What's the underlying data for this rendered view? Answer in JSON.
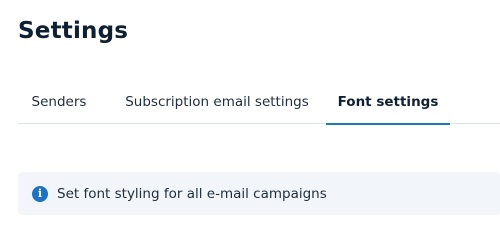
{
  "page": {
    "title": "Settings"
  },
  "tabs": [
    {
      "label": "Senders",
      "active": false
    },
    {
      "label": "Subscription email settings",
      "active": false
    },
    {
      "label": "Font settings",
      "active": true
    }
  ],
  "info_banner": {
    "icon": "info-icon",
    "text": "Set font styling for all e-mail campaigns"
  },
  "colors": {
    "accent": "#1f7ab8",
    "info_icon": "#1a73c7",
    "banner_background": "#f2f6fa",
    "title_text": "#0f2032"
  }
}
